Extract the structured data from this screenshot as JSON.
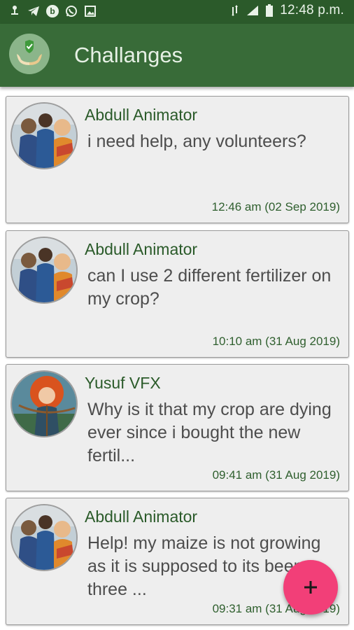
{
  "status_bar": {
    "time": "12:48 p.m.",
    "left_icons": [
      "usb-debug-icon",
      "telegram-icon",
      "b-app-icon",
      "whatsapp-icon",
      "image-icon"
    ],
    "right_icons": [
      "network-type-icon",
      "signal-icon",
      "battery-icon"
    ],
    "b_app_letter": "b"
  },
  "app_bar": {
    "title": "Challanges",
    "logo_icon": "hands-shield-icon"
  },
  "posts": [
    {
      "author": "Abdull Animator",
      "message": "i need help, any volunteers?",
      "timestamp": "12:46 am (02 Sep 2019)",
      "avatar": "avatar-trio-icon"
    },
    {
      "author": "Abdull Animator",
      "message": "can I use 2 different fertilizer on my crop?",
      "timestamp": "10:10 am (31 Aug 2019)",
      "avatar": "avatar-trio-icon"
    },
    {
      "author": "Yusuf VFX",
      "message": "Why is it that my crop are dying ever since i bought the new fertil...",
      "timestamp": "09:41 am (31 Aug 2019)",
      "avatar": "avatar-archer-icon"
    },
    {
      "author": "Abdull Animator",
      "message": "Help! my maize is not growing as it is supposed to its been three ...",
      "timestamp": "09:31 am (31 Aug 2019)",
      "avatar": "avatar-trio-icon"
    }
  ],
  "fab": {
    "icon": "plus-icon"
  },
  "colors": {
    "status_bar": "#2b5a2a",
    "app_bar": "#386b38",
    "card_background": "#eeeeee",
    "name_text": "#2a5a29",
    "message_text": "#4d4d4d",
    "fab": "#f23f78"
  }
}
